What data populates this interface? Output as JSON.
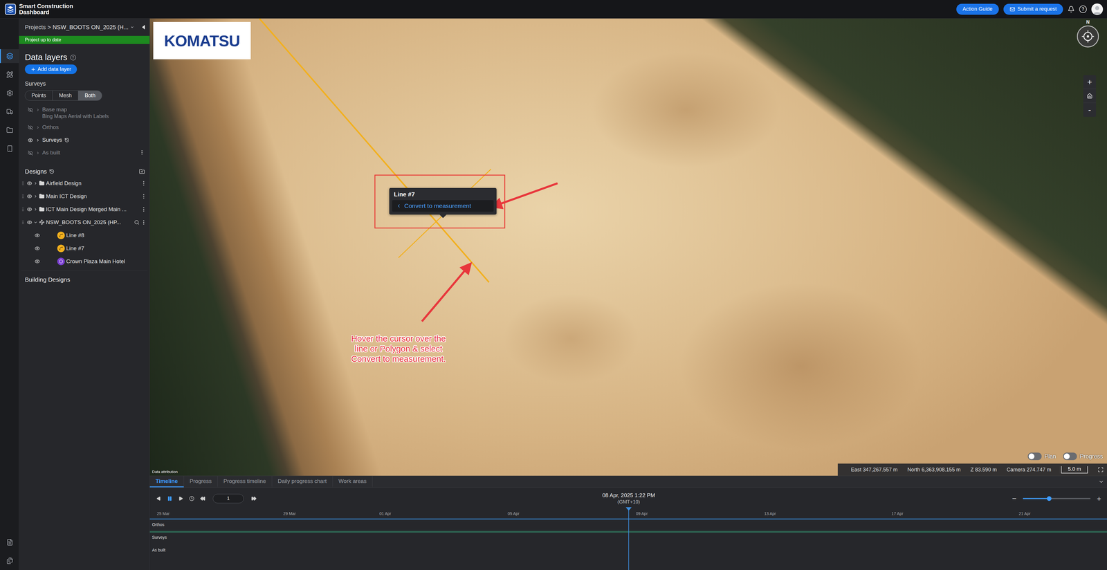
{
  "top_bar": {
    "brand_title": "Smart Construction",
    "brand_subtitle": "Dashboard",
    "buttons": [
      {
        "label": "Action Guide",
        "kind": "plain"
      },
      {
        "label": "Submit a request",
        "kind": "mail"
      }
    ],
    "help": "?"
  },
  "rail": {
    "top": [
      {
        "selected": true
      },
      {
        "selected": false
      },
      {
        "selected": false
      },
      {
        "selected": false
      },
      {
        "selected": false
      },
      {
        "selected": false
      }
    ],
    "bottom": [
      {
        "selected": false
      },
      {
        "selected": false
      }
    ]
  },
  "project": {
    "root": "Projects",
    "separator": ">",
    "name": "NSW_BOOTS ON_2025 (H...",
    "status": "Project up to date"
  },
  "data_layers": {
    "title": "Data layers",
    "help": "?",
    "add_button": "Add data layer",
    "surveys_label": "Surveys",
    "view_modes": [
      {
        "label": "Points",
        "selected": false
      },
      {
        "label": "Mesh",
        "selected": false
      },
      {
        "label": "Both",
        "selected": true
      }
    ],
    "layers": [
      {
        "name": "Base map",
        "subtitle": "Bing Maps Aerial with Labels",
        "visible": false,
        "history": false,
        "menu": false
      },
      {
        "name": "Orthos",
        "subtitle": "",
        "visible": false,
        "history": false,
        "menu": false
      },
      {
        "name": "Surveys",
        "subtitle": "",
        "visible": true,
        "history": true,
        "menu": false
      },
      {
        "name": "As built",
        "subtitle": "",
        "visible": false,
        "history": false,
        "menu": true
      }
    ]
  },
  "designs": {
    "title": "Designs",
    "building_designs": "Building Designs",
    "items": [
      {
        "name": "Airfield Design",
        "kind": "folder",
        "visible": true,
        "expanded": false,
        "search": false,
        "children": []
      },
      {
        "name": "Main ICT Design",
        "kind": "folder",
        "visible": true,
        "expanded": false,
        "search": false,
        "children": []
      },
      {
        "name": "ICT Main Design Merged Main ...",
        "kind": "folder",
        "visible": true,
        "expanded": false,
        "search": false,
        "children": []
      },
      {
        "name": "NSW_BOOTS ON_2025 (HP...",
        "kind": "design",
        "visible": true,
        "expanded": true,
        "search": true,
        "children": [
          {
            "name": "Line #8",
            "kind": "line",
            "visible": true,
            "color": "#f2b01e"
          },
          {
            "name": "Line #7",
            "kind": "line",
            "visible": true,
            "color": "#f2b01e"
          },
          {
            "name": "Crown Plaza Main Hotel",
            "kind": "polygon",
            "visible": true,
            "color": "#7a3fd1"
          }
        ]
      }
    ]
  },
  "map": {
    "logo": "KOMATSU",
    "popup": {
      "title": "Line #7",
      "action": "Convert to measurement"
    },
    "annotation": [
      "Hover the cursor over the",
      "line or Polygon & select",
      "Convert to measurement."
    ],
    "attribution": "Data attribution",
    "compass": "N",
    "zoom_in": "+",
    "zoom_out": "-",
    "toggles": [
      {
        "label": "Plan",
        "on": false
      },
      {
        "label": "Progress",
        "on": false
      }
    ],
    "coordinates": [
      "East 347,267.557 m",
      "North 6,363,908.155 m",
      "Z 83.590 m",
      "Camera 274.747 m"
    ],
    "scale": "5.0 m"
  },
  "timeline": {
    "tabs": [
      {
        "label": "Timeline",
        "selected": true
      },
      {
        "label": "Progress",
        "selected": false
      },
      {
        "label": "Progress timeline",
        "selected": false
      },
      {
        "label": "Daily progress chart",
        "selected": false
      },
      {
        "label": "Work areas",
        "selected": false
      }
    ],
    "playing": true,
    "frame": "1",
    "date": "08 Apr, 2025 1:22 PM",
    "timezone": "(GMT+10)",
    "zoom": {
      "minus": "−",
      "plus": "+",
      "level": 0.39
    },
    "ticks": [
      "25 Mar",
      "29 Mar",
      "01 Apr",
      "05 Apr",
      "09 Apr",
      "13 Apr",
      "17 Apr",
      "21 Apr"
    ],
    "playhead": 0.5,
    "rows": [
      {
        "label": "Orthos",
        "track": true,
        "color": "#2d5277"
      },
      {
        "label": "Surveys",
        "track": true,
        "color": "#2d6150"
      },
      {
        "label": "As built",
        "track": false
      }
    ]
  }
}
